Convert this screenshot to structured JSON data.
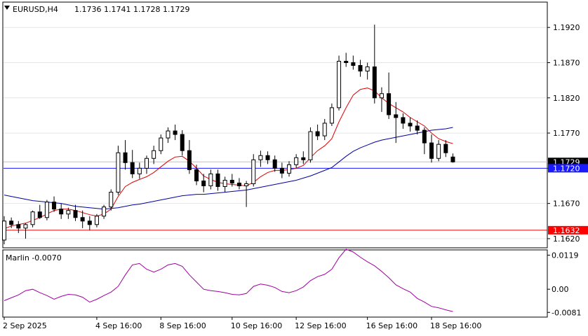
{
  "header": {
    "symbol": "EURUSD,H4",
    "ohlc": "1.1736 1.1741 1.1728 1.1729"
  },
  "oscillator": {
    "label": "Marlin -0.0070",
    "ticks": [
      {
        "text": "0.0119",
        "value": 0.0119
      },
      {
        "text": "0.00",
        "value": 0.0
      },
      {
        "text": "-0.0081",
        "value": -0.0081
      }
    ]
  },
  "chart_data": {
    "type": "candlestick",
    "x_ticks": [
      "2 Sep 2025",
      "4 Sep 16:00",
      "8 Sep 16:00",
      "10 Sep 16:00",
      "12 Sep 16:00",
      "16 Sep 16:00",
      "18 Sep 16:00"
    ],
    "y_ticks": [
      1.192,
      1.187,
      1.182,
      1.177,
      1.172,
      1.167,
      1.162
    ],
    "y_tick_labels": [
      "1.1920",
      "1.1870",
      "1.1820",
      "1.1770",
      "1.1720",
      "1.1670",
      "1.1620"
    ],
    "ylim": [
      1.1608,
      1.1955
    ],
    "price_labels": [
      {
        "text": "1.1729",
        "value": 1.1729,
        "color": "#000000"
      },
      {
        "text": "1.1720",
        "value": 1.172,
        "color": "#1a1aff"
      },
      {
        "text": "1.1632",
        "value": 1.1632,
        "color": "#ff0000"
      }
    ],
    "hlines": [
      {
        "value": 1.172,
        "color": "#1a1aff"
      },
      {
        "value": 1.1632,
        "color": "#e00000"
      }
    ],
    "candles": [
      [
        1.1618,
        1.1652,
        1.1612,
        1.1645
      ],
      [
        1.1645,
        1.165,
        1.1635,
        1.164
      ],
      [
        1.164,
        1.1645,
        1.1628,
        1.1635
      ],
      [
        1.1635,
        1.1642,
        1.162,
        1.164
      ],
      [
        1.164,
        1.166,
        1.1636,
        1.1658
      ],
      [
        1.1658,
        1.1668,
        1.1648,
        1.165
      ],
      [
        1.165,
        1.1675,
        1.1646,
        1.1672
      ],
      [
        1.1672,
        1.168,
        1.1658,
        1.1662
      ],
      [
        1.1662,
        1.167,
        1.1648,
        1.1655
      ],
      [
        1.1655,
        1.1664,
        1.1648,
        1.166
      ],
      [
        1.166,
        1.1668,
        1.1645,
        1.165
      ],
      [
        1.165,
        1.166,
        1.1635,
        1.1645
      ],
      [
        1.1645,
        1.1652,
        1.1632,
        1.164
      ],
      [
        1.164,
        1.1655,
        1.1636,
        1.1652
      ],
      [
        1.1652,
        1.1668,
        1.1648,
        1.1665
      ],
      [
        1.1665,
        1.169,
        1.166,
        1.1686
      ],
      [
        1.1686,
        1.1752,
        1.1682,
        1.1742
      ],
      [
        1.1742,
        1.176,
        1.1718,
        1.1728
      ],
      [
        1.1728,
        1.1746,
        1.1706,
        1.1712
      ],
      [
        1.1712,
        1.1728,
        1.1705,
        1.172
      ],
      [
        1.172,
        1.1738,
        1.1712,
        1.1734
      ],
      [
        1.1734,
        1.1752,
        1.1726,
        1.1745
      ],
      [
        1.1745,
        1.1768,
        1.174,
        1.1763
      ],
      [
        1.1763,
        1.1778,
        1.1756,
        1.1773
      ],
      [
        1.1773,
        1.1782,
        1.176,
        1.1768
      ],
      [
        1.1768,
        1.1774,
        1.1738,
        1.1745
      ],
      [
        1.1745,
        1.176,
        1.1712,
        1.1718
      ],
      [
        1.1718,
        1.1725,
        1.1696,
        1.1702
      ],
      [
        1.1702,
        1.1712,
        1.1686,
        1.1695
      ],
      [
        1.1695,
        1.1718,
        1.169,
        1.1712
      ],
      [
        1.1712,
        1.1718,
        1.1688,
        1.1694
      ],
      [
        1.1694,
        1.1708,
        1.1686,
        1.1703
      ],
      [
        1.1703,
        1.1712,
        1.1694,
        1.1699
      ],
      [
        1.1699,
        1.1706,
        1.169,
        1.1695
      ],
      [
        1.1695,
        1.1702,
        1.1665,
        1.1698
      ],
      [
        1.1698,
        1.174,
        1.1694,
        1.1732
      ],
      [
        1.1732,
        1.1745,
        1.1722,
        1.1738
      ],
      [
        1.1738,
        1.1744,
        1.1726,
        1.1732
      ],
      [
        1.1732,
        1.1738,
        1.1715,
        1.172
      ],
      [
        1.172,
        1.1728,
        1.1706,
        1.1713
      ],
      [
        1.1713,
        1.173,
        1.1708,
        1.1725
      ],
      [
        1.1725,
        1.174,
        1.172,
        1.1735
      ],
      [
        1.1735,
        1.1744,
        1.1726,
        1.1732
      ],
      [
        1.1732,
        1.1778,
        1.1728,
        1.1772
      ],
      [
        1.1772,
        1.1782,
        1.176,
        1.1766
      ],
      [
        1.1766,
        1.179,
        1.176,
        1.1784
      ],
      [
        1.1784,
        1.1812,
        1.178,
        1.1806
      ],
      [
        1.1806,
        1.188,
        1.1802,
        1.1872
      ],
      [
        1.1872,
        1.1884,
        1.1864,
        1.187
      ],
      [
        1.187,
        1.188,
        1.186,
        1.1866
      ],
      [
        1.1866,
        1.1874,
        1.185,
        1.1858
      ],
      [
        1.1858,
        1.187,
        1.1846,
        1.1864
      ],
      [
        1.1864,
        1.1924,
        1.1812,
        1.182
      ],
      [
        1.182,
        1.1835,
        1.18,
        1.1826
      ],
      [
        1.1826,
        1.1856,
        1.179,
        1.1796
      ],
      [
        1.1796,
        1.1814,
        1.1756,
        1.1792
      ],
      [
        1.1792,
        1.1798,
        1.1776,
        1.1784
      ],
      [
        1.1784,
        1.1792,
        1.1772,
        1.178
      ],
      [
        1.178,
        1.1788,
        1.1768,
        1.1774
      ],
      [
        1.1774,
        1.1778,
        1.174,
        1.1756
      ],
      [
        1.1756,
        1.1768,
        1.1728,
        1.1734
      ],
      [
        1.1734,
        1.176,
        1.173,
        1.1754
      ],
      [
        1.1754,
        1.176,
        1.1736,
        1.1742
      ],
      [
        1.1736,
        1.1741,
        1.1728,
        1.1729
      ]
    ],
    "red_line": [
      1.1634,
      1.1638,
      1.164,
      1.1642,
      1.1646,
      1.165,
      1.1655,
      1.166,
      1.1662,
      1.1662,
      1.166,
      1.1657,
      1.1654,
      1.1652,
      1.1655,
      1.1662,
      1.168,
      1.1694,
      1.17,
      1.1704,
      1.1708,
      1.1714,
      1.1722,
      1.173,
      1.1736,
      1.1737,
      1.173,
      1.172,
      1.1709,
      1.1704,
      1.17,
      1.1698,
      1.1697,
      1.1696,
      1.1695,
      1.17,
      1.1708,
      1.1714,
      1.1717,
      1.1717,
      1.1718,
      1.172,
      1.1724,
      1.1735,
      1.1745,
      1.1752,
      1.1762,
      1.1786,
      1.1806,
      1.1824,
      1.1832,
      1.1834,
      1.183,
      1.182,
      1.1812,
      1.1806,
      1.18,
      1.1792,
      1.1786,
      1.178,
      1.177,
      1.1762,
      1.1758,
      1.1755
    ],
    "blue_line": [
      1.1682,
      1.168,
      1.1678,
      1.1676,
      1.1674,
      1.1673,
      1.1672,
      1.1671,
      1.167,
      1.1668,
      1.1666,
      1.1665,
      1.1664,
      1.1663,
      1.1662,
      1.1663,
      1.1664,
      1.1666,
      1.1668,
      1.1669,
      1.1671,
      1.1673,
      1.1675,
      1.1677,
      1.1679,
      1.1681,
      1.1682,
      1.1683,
      1.1683,
      1.1684,
      1.1685,
      1.1686,
      1.1687,
      1.1688,
      1.1689,
      1.1691,
      1.1693,
      1.1695,
      1.1697,
      1.1699,
      1.1701,
      1.1703,
      1.1706,
      1.1709,
      1.1713,
      1.1717,
      1.1721,
      1.1729,
      1.1737,
      1.1744,
      1.1749,
      1.1753,
      1.1757,
      1.176,
      1.1762,
      1.1764,
      1.1766,
      1.1768,
      1.177,
      1.1772,
      1.1774,
      1.1775,
      1.1776,
      1.1778
    ],
    "marlin_line": [
      -0.004,
      -0.003,
      -0.002,
      -0.0005,
      0.0,
      -0.0012,
      -0.0022,
      -0.0035,
      -0.0025,
      -0.0018,
      -0.002,
      -0.0028,
      -0.0045,
      -0.0035,
      -0.0022,
      -0.001,
      0.001,
      0.005,
      0.0085,
      0.009,
      0.007,
      0.006,
      0.007,
      0.0085,
      0.009,
      0.008,
      0.005,
      0.0025,
      0.0,
      -0.0005,
      -0.0008,
      -0.0012,
      -0.0018,
      -0.002,
      -0.0015,
      0.001,
      0.0018,
      0.0014,
      0.0006,
      -0.0008,
      -0.0012,
      -0.0005,
      0.0008,
      0.003,
      0.0044,
      0.0052,
      0.007,
      0.011,
      0.014,
      0.013,
      0.0112,
      0.0096,
      0.0082,
      0.0062,
      0.004,
      0.0015,
      0.0002,
      -0.001,
      -0.0032,
      -0.0045,
      -0.006,
      -0.0065,
      -0.0072,
      -0.0078
    ]
  }
}
